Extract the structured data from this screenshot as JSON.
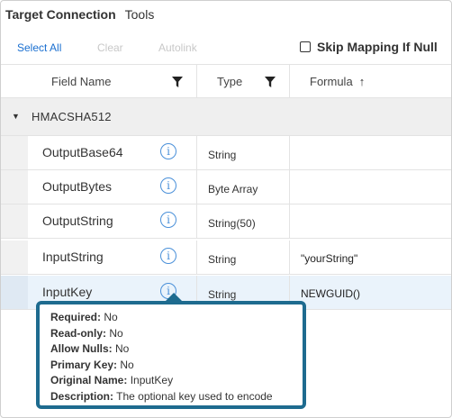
{
  "menu": {
    "title": "Target Connection",
    "tools": "Tools"
  },
  "toolbar": {
    "select_all": "Select All",
    "clear": "Clear",
    "autolink": "Autolink",
    "skip_mapping": "Skip Mapping If Null"
  },
  "columns": {
    "field_name": "Field Name",
    "type": "Type",
    "formula": "Formula",
    "sort_arrow": "↑"
  },
  "group": {
    "name": "HMACSHA512",
    "caret": "▼"
  },
  "rows": [
    {
      "field": "OutputBase64",
      "type": "String",
      "formula": ""
    },
    {
      "field": "OutputBytes",
      "type": "Byte Array",
      "formula": ""
    },
    {
      "field": "OutputString",
      "type": "String(50)",
      "formula": ""
    },
    {
      "field": "InputString",
      "type": "String",
      "formula": "\"yourString\""
    },
    {
      "field": "InputKey",
      "type": "String",
      "formula": "NEWGUID()"
    }
  ],
  "info_glyph": "i",
  "tooltip": {
    "required_label": "Required:",
    "required_value": "No",
    "readonly_label": "Read-only:",
    "readonly_value": "No",
    "allownulls_label": "Allow Nulls:",
    "allownulls_value": "No",
    "primarykey_label": "Primary Key:",
    "primarykey_value": "No",
    "originalname_label": "Original Name:",
    "originalname_value": "InputKey",
    "description_label": "Description:",
    "description_value": "The optional key used to encode"
  },
  "colors": {
    "link": "#1a6fd0",
    "info": "#4a90d9",
    "tooltip_border": "#1e6b8f",
    "highlight_row": "#eaf3fb"
  }
}
